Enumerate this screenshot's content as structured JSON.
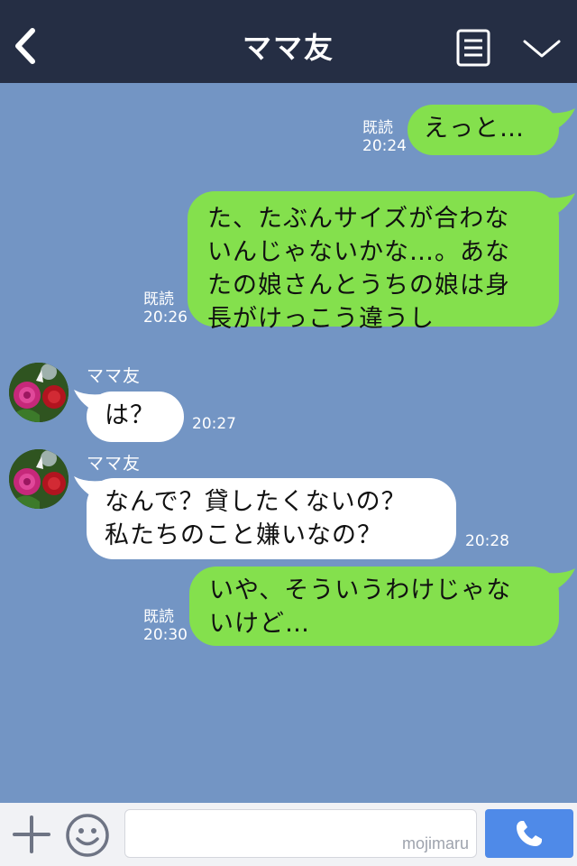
{
  "header": {
    "title": "ママ友"
  },
  "messages": [
    {
      "type": "sent",
      "read": "既読",
      "time": "20:24",
      "text": "えっと…"
    },
    {
      "type": "sent",
      "read": "既読",
      "time": "20:26",
      "lines": [
        "た、たぶんサイズが合わな",
        "いんじゃないかな…。あな",
        "たの娘さんとうちの娘は身",
        "長がけっこう違うし"
      ]
    },
    {
      "type": "received",
      "sender": "ママ友",
      "time": "20:27",
      "text": "は？"
    },
    {
      "type": "received",
      "sender": "ママ友",
      "time": "20:28",
      "lines": [
        "なんで？貸したくないの？",
        "私たちのこと嫌いなの？"
      ]
    },
    {
      "type": "sent",
      "read": "既読",
      "time": "20:30",
      "lines": [
        "いや、そういうわけじゃな",
        "いけど…"
      ]
    }
  ],
  "input": {
    "watermark": "mojimaru"
  },
  "icons": {
    "back": "chevron-left-icon",
    "notes": "notes-icon",
    "menu": "chevron-down-icon",
    "plus": "plus-icon",
    "emoji": "emoji-icon",
    "call": "phone-icon"
  },
  "colors": {
    "header_bg": "#252e44",
    "chat_bg": "#7395c4",
    "sent_bubble": "#84e04d",
    "received_bubble": "#ffffff",
    "call_button": "#4f8ae8"
  }
}
